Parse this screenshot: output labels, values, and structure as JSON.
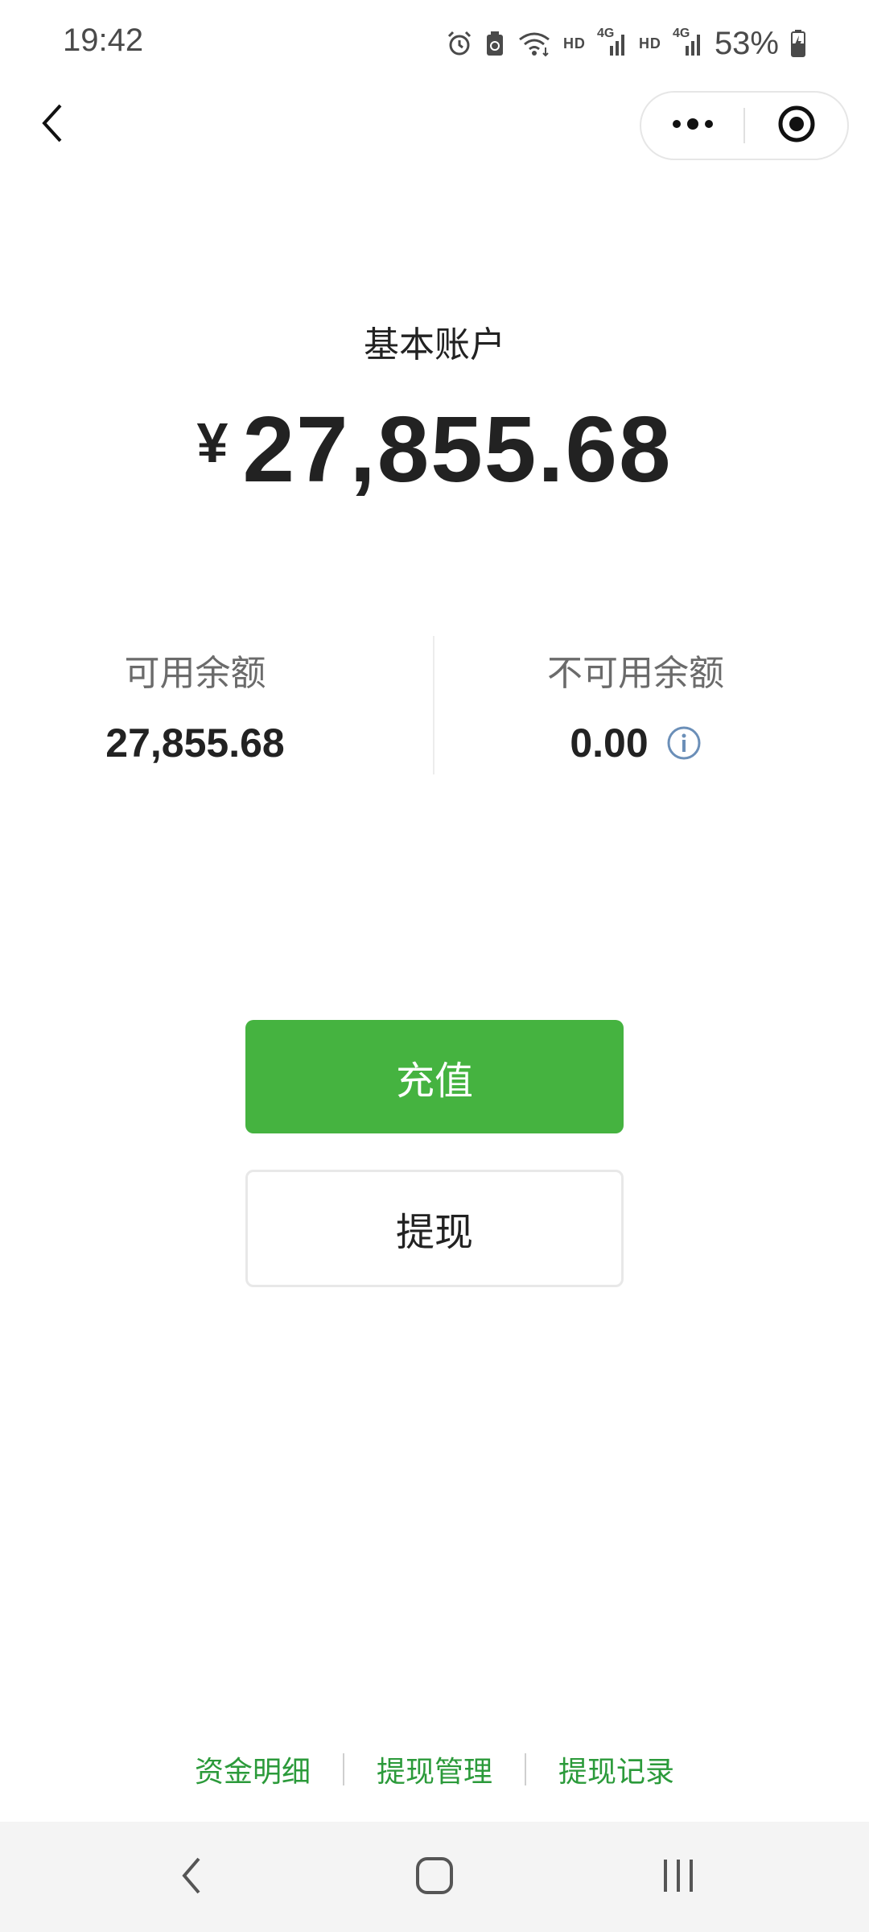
{
  "status_bar": {
    "time": "19:42",
    "hd_label_1": "HD",
    "hd_label_2": "HD",
    "network_1": "4G",
    "network_2": "4G",
    "battery": "53%",
    "icons": [
      "alarm-icon",
      "recycle-icon",
      "wifi-icon",
      "signal-icon",
      "signal-icon",
      "battery-charging-icon"
    ]
  },
  "header": {
    "back_icon": "chevron-left-icon",
    "more_icon": "more-dots-icon",
    "close_icon": "target-circle-icon"
  },
  "account": {
    "title": "基本账户",
    "currency": "¥",
    "balance": "27,855.68"
  },
  "available": {
    "label": "可用余额",
    "value": "27,855.68"
  },
  "unavailable": {
    "label": "不可用余额",
    "value": "0.00",
    "info_icon": "info-icon"
  },
  "buttons": {
    "recharge": "充值",
    "withdraw": "提现"
  },
  "footer_links": [
    "资金明细",
    "提现管理",
    "提现记录"
  ],
  "nav": {
    "back_icon": "nav-back-icon",
    "home_icon": "nav-home-icon",
    "recents_icon": "nav-recents-icon"
  },
  "colors": {
    "primary_green": "#45b340",
    "link_green": "#2b9a3a",
    "info_blue": "#6b8fb8",
    "text_dark": "#222222",
    "text_muted": "#6b6b6b"
  }
}
